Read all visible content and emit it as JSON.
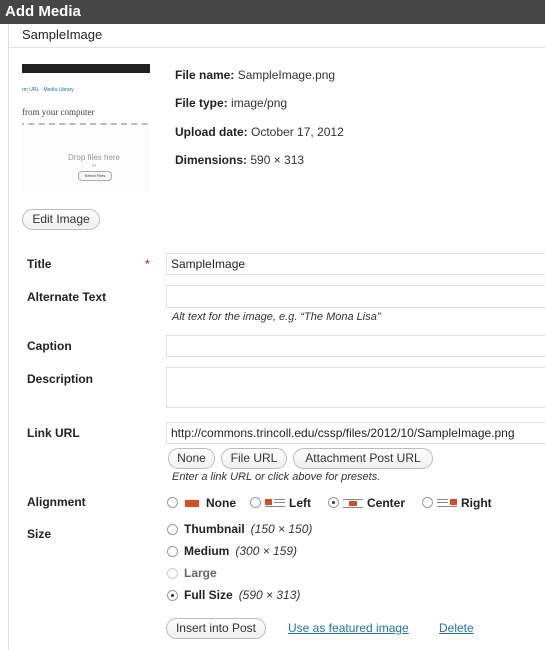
{
  "window": {
    "title": "Add Media"
  },
  "item": {
    "title": "SampleImage"
  },
  "thumbnail": {
    "links": "rm URL · Media Library",
    "upload_text": "from your computer",
    "drop_text": "Drop files here",
    "or_text": "or",
    "select_label": "Select Files"
  },
  "meta": {
    "file_name_label": "File name:",
    "file_name": "SampleImage.png",
    "file_type_label": "File type:",
    "file_type": "image/png",
    "upload_date_label": "Upload date:",
    "upload_date": "October 17, 2012",
    "dimensions_label": "Dimensions:",
    "dimensions": "590 × 313"
  },
  "buttons": {
    "edit_image": "Edit Image"
  },
  "fields": {
    "title_label": "Title",
    "title_value": "SampleImage",
    "required_mark": "*",
    "alt_label": "Alternate Text",
    "alt_value": "",
    "alt_help": "Alt text for the image, e.g. “The Mona Lisa”",
    "caption_label": "Caption",
    "caption_value": "",
    "description_label": "Description",
    "description_value": "",
    "link_label": "Link URL",
    "link_value": "http://commons.trincoll.edu/cssp/files/2012/10/SampleImage.png",
    "link_help": "Enter a link URL or click above for presets."
  },
  "link_presets": {
    "none": "None",
    "file_url": "File URL",
    "attachment_post_url": "Attachment Post URL"
  },
  "alignment": {
    "label": "Alignment",
    "options": [
      {
        "label": "None",
        "checked": false
      },
      {
        "label": "Left",
        "checked": false
      },
      {
        "label": "Center",
        "checked": true
      },
      {
        "label": "Right",
        "checked": false
      }
    ]
  },
  "size": {
    "label": "Size",
    "options": [
      {
        "label": "Thumbnail",
        "dims": "(150 × 150)",
        "checked": false,
        "disabled": false
      },
      {
        "label": "Medium",
        "dims": "(300 × 159)",
        "checked": false,
        "disabled": false
      },
      {
        "label": "Large",
        "dims": "",
        "checked": false,
        "disabled": true
      },
      {
        "label": "Full Size",
        "dims": "(590 × 313)",
        "checked": true,
        "disabled": false
      }
    ]
  },
  "actions": {
    "insert": "Insert into Post",
    "featured": "Use as featured image",
    "delete": "Delete"
  },
  "colors": {
    "accent": "#d54e21",
    "link": "#21759b",
    "titlebar": "#464646"
  }
}
